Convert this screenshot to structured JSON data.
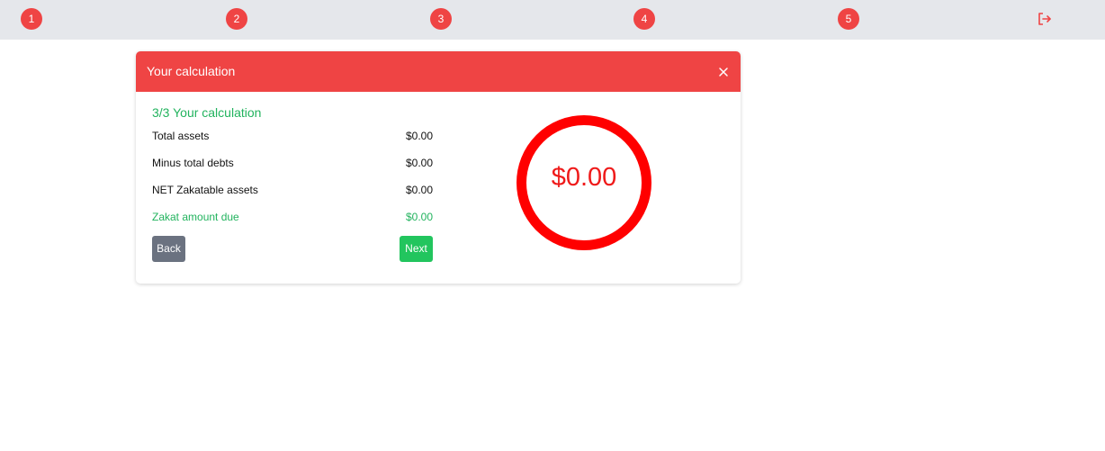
{
  "topbar": {
    "steps": [
      "1",
      "2",
      "3",
      "4",
      "5"
    ],
    "logout_icon": "logout-icon"
  },
  "modal": {
    "title": "Your calculation",
    "close_icon": "close-icon",
    "subtitle": "3/3 Your calculation",
    "rows": [
      {
        "label": "Total assets",
        "value": "$0.00"
      },
      {
        "label": "Minus total debts",
        "value": "$0.00"
      },
      {
        "label": "NET Zakatable assets",
        "value": "$0.00"
      },
      {
        "label": "Zakat amount due",
        "value": "$0.00"
      }
    ],
    "back_label": "Back",
    "next_label": "Next",
    "ring_value": "$0.00"
  },
  "colors": {
    "accent_red": "#ef4444",
    "green": "#22b35e",
    "gray_button": "#6b7280",
    "ring_red": "#ff0000"
  }
}
